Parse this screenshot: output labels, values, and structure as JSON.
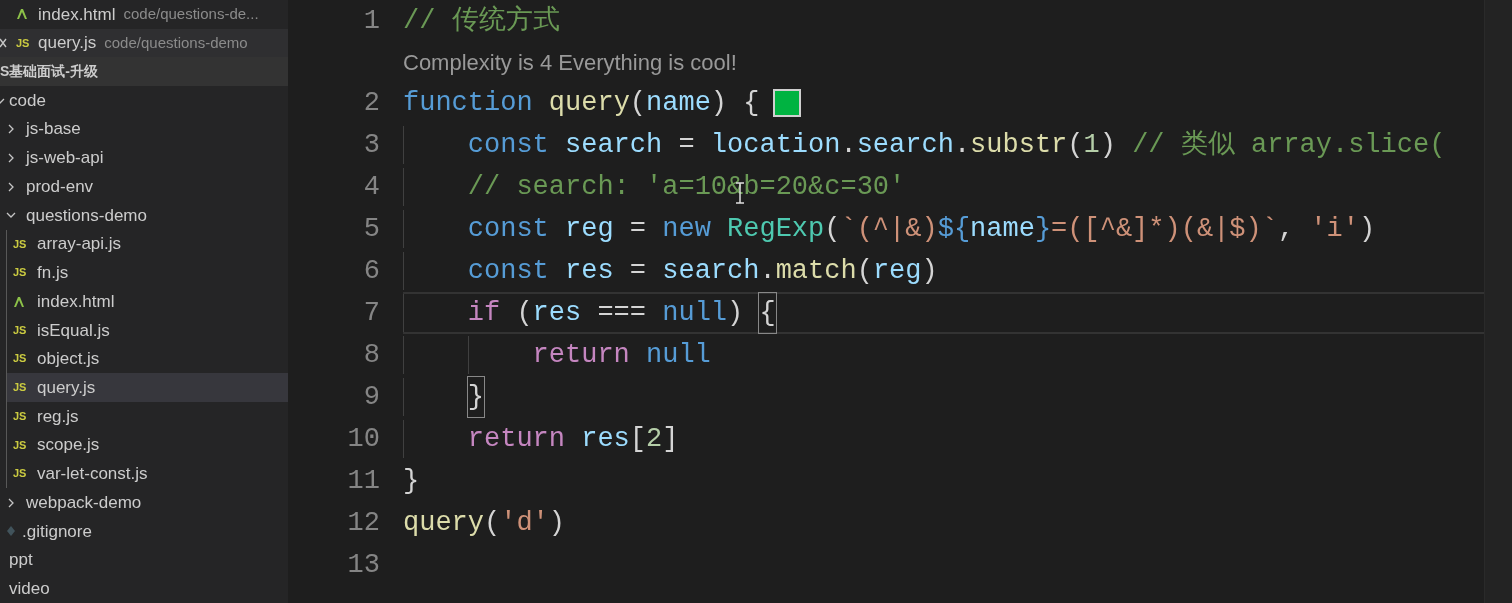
{
  "open_editors": [
    {
      "name": "index.html",
      "path": "code/questions-de...",
      "kind": "html",
      "active": false
    },
    {
      "name": "query.js",
      "path": "code/questions-demo",
      "kind": "js",
      "badge": "JS",
      "active": true
    }
  ],
  "explorer": {
    "title": "S基础面试-升级",
    "items": [
      {
        "label": "code",
        "kind": "folder",
        "expanded": true,
        "selected": false,
        "children": [
          {
            "label": "js-base",
            "kind": "folder",
            "expanded": false,
            "selected": false
          },
          {
            "label": "js-web-api",
            "kind": "folder",
            "expanded": false,
            "selected": false
          },
          {
            "label": "prod-env",
            "kind": "folder",
            "expanded": false,
            "selected": false
          },
          {
            "label": "questions-demo",
            "kind": "folder",
            "expanded": true,
            "selected": false,
            "children": [
              {
                "label": "array-api.js",
                "kind": "js",
                "badge": "JS",
                "selected": false
              },
              {
                "label": "fn.js",
                "kind": "js",
                "badge": "JS",
                "selected": false
              },
              {
                "label": "index.html",
                "kind": "html",
                "selected": false
              },
              {
                "label": "isEqual.js",
                "kind": "js",
                "badge": "JS",
                "selected": false
              },
              {
                "label": "object.js",
                "kind": "js",
                "badge": "JS",
                "selected": false
              },
              {
                "label": "query.js",
                "kind": "js",
                "badge": "JS",
                "selected": true
              },
              {
                "label": "reg.js",
                "kind": "js",
                "badge": "JS",
                "selected": false
              },
              {
                "label": "scope.js",
                "kind": "js",
                "badge": "JS",
                "selected": false
              },
              {
                "label": "var-let-const.js",
                "kind": "js",
                "badge": "JS",
                "selected": false
              }
            ]
          },
          {
            "label": "webpack-demo",
            "kind": "folder",
            "expanded": false,
            "selected": false
          },
          {
            "label": ".gitignore",
            "kind": "git",
            "selected": false
          }
        ]
      },
      {
        "label": "ppt",
        "kind": "file",
        "selected": false
      },
      {
        "label": "video",
        "kind": "file",
        "selected": false
      }
    ]
  },
  "editor": {
    "lines": [
      {
        "number": "1",
        "current": false,
        "tokens": [
          {
            "text": "// 传统方式",
            "kind": "comment"
          }
        ],
        "codelens": "Complexity is 4 Everything is cool!"
      },
      {
        "number": "2",
        "current": false,
        "swatch": true,
        "tokens": [
          {
            "text": "function ",
            "kind": "keyword"
          },
          {
            "text": "query",
            "kind": "func"
          },
          {
            "text": "(",
            "kind": "plain"
          },
          {
            "text": "name",
            "kind": "var"
          },
          {
            "text": ") {",
            "kind": "plain"
          }
        ],
        "children": [
          {
            "number": "3",
            "current": false,
            "tokens": [
              {
                "text": "const ",
                "kind": "keyword"
              },
              {
                "text": "search",
                "kind": "var"
              },
              {
                "text": " = ",
                "kind": "plain"
              },
              {
                "text": "location",
                "kind": "var"
              },
              {
                "text": ".",
                "kind": "plain"
              },
              {
                "text": "search",
                "kind": "var"
              },
              {
                "text": ".",
                "kind": "plain"
              },
              {
                "text": "substr",
                "kind": "func"
              },
              {
                "text": "(",
                "kind": "plain"
              },
              {
                "text": "1",
                "kind": "number"
              },
              {
                "text": ") ",
                "kind": "plain"
              },
              {
                "text": "// 类似 array.slice(",
                "kind": "comment"
              }
            ]
          },
          {
            "number": "4",
            "current": false,
            "cursor": true,
            "tokens": [
              {
                "text": "// search: 'a=10&b=20&c=30'",
                "kind": "comment"
              }
            ]
          },
          {
            "number": "5",
            "current": false,
            "tokens": [
              {
                "text": "const ",
                "kind": "keyword"
              },
              {
                "text": "reg",
                "kind": "var"
              },
              {
                "text": " = ",
                "kind": "plain"
              },
              {
                "text": "new ",
                "kind": "keyword"
              },
              {
                "text": "RegExp",
                "kind": "class"
              },
              {
                "text": "(",
                "kind": "plain"
              },
              {
                "text": "`(^|&)",
                "kind": "string"
              },
              {
                "text": "${",
                "kind": "keyword"
              },
              {
                "text": "name",
                "kind": "var"
              },
              {
                "text": "}",
                "kind": "keyword"
              },
              {
                "text": "=([^&]*)(&|$)`",
                "kind": "string"
              },
              {
                "text": ", ",
                "kind": "plain"
              },
              {
                "text": "'i'",
                "kind": "string"
              },
              {
                "text": ")",
                "kind": "plain"
              }
            ]
          },
          {
            "number": "6",
            "current": false,
            "tokens": [
              {
                "text": "const ",
                "kind": "keyword"
              },
              {
                "text": "res",
                "kind": "var"
              },
              {
                "text": " = ",
                "kind": "plain"
              },
              {
                "text": "search",
                "kind": "var"
              },
              {
                "text": ".",
                "kind": "plain"
              },
              {
                "text": "match",
                "kind": "func"
              },
              {
                "text": "(",
                "kind": "plain"
              },
              {
                "text": "reg",
                "kind": "var"
              },
              {
                "text": ")",
                "kind": "plain"
              }
            ]
          },
          {
            "number": "7",
            "current": true,
            "tokens": [
              {
                "text": "if",
                "kind": "control"
              },
              {
                "text": " (",
                "kind": "plain"
              },
              {
                "text": "res",
                "kind": "var"
              },
              {
                "text": " === ",
                "kind": "plain"
              },
              {
                "text": "null",
                "kind": "keyword"
              },
              {
                "text": ") ",
                "kind": "plain"
              },
              {
                "text": "{",
                "kind": "plain",
                "matched": true
              }
            ],
            "children": [
              {
                "number": "8",
                "current": false,
                "tokens": [
                  {
                    "text": "return ",
                    "kind": "control"
                  },
                  {
                    "text": "null",
                    "kind": "keyword"
                  }
                ]
              }
            ]
          },
          {
            "number": "9",
            "current": false,
            "tokens": [
              {
                "text": "}",
                "kind": "plain",
                "matched": true
              }
            ]
          },
          {
            "number": "10",
            "current": false,
            "tokens": [
              {
                "text": "return ",
                "kind": "control"
              },
              {
                "text": "res",
                "kind": "var"
              },
              {
                "text": "[",
                "kind": "plain"
              },
              {
                "text": "2",
                "kind": "number"
              },
              {
                "text": "]",
                "kind": "plain"
              }
            ]
          }
        ]
      },
      {
        "number": "11",
        "current": false,
        "tokens": [
          {
            "text": "}",
            "kind": "plain"
          }
        ]
      },
      {
        "number": "12",
        "current": false,
        "tokens": [
          {
            "text": "query",
            "kind": "func"
          },
          {
            "text": "(",
            "kind": "plain"
          },
          {
            "text": "'d'",
            "kind": "string"
          },
          {
            "text": ")",
            "kind": "plain"
          }
        ]
      },
      {
        "number": "13",
        "current": false
      }
    ]
  }
}
